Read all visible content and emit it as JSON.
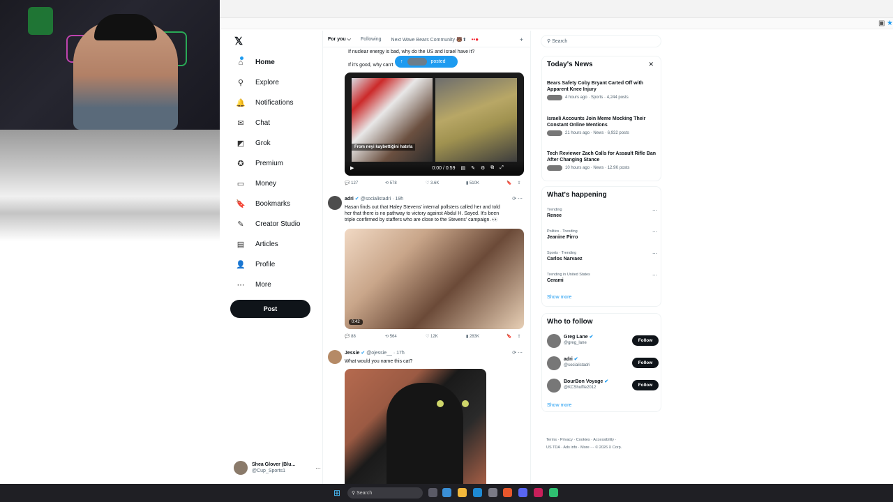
{
  "nav": {
    "logo": "𝕏",
    "items": [
      {
        "label": "Home",
        "icon": "⌂"
      },
      {
        "label": "Explore",
        "icon": "⚲"
      },
      {
        "label": "Notifications",
        "icon": "🔔"
      },
      {
        "label": "Chat",
        "icon": "✉"
      },
      {
        "label": "Grok",
        "icon": "◩"
      },
      {
        "label": "Premium",
        "icon": "✪"
      },
      {
        "label": "Money",
        "icon": "▭"
      },
      {
        "label": "Bookmarks",
        "icon": "🔖"
      },
      {
        "label": "Creator Studio",
        "icon": "✎"
      },
      {
        "label": "Articles",
        "icon": "▤"
      },
      {
        "label": "Profile",
        "icon": "👤"
      },
      {
        "label": "More",
        "icon": "⋯"
      }
    ],
    "post_label": "Post",
    "account": {
      "name": "Shea Glover (Blu...",
      "handle": "@Cup_Sports1"
    }
  },
  "tabs": {
    "items": [
      "For you",
      "Following",
      "Next Wave Bears Community 🐻⬆"
    ],
    "chevron": "⌵",
    "dots": "••●",
    "plus": "+"
  },
  "feed": {
    "line1": "If nuclear energy is bad, why do the US and Israel have it?",
    "line2": "If it's good, why can't",
    "posted_label": "posted",
    "video1": {
      "caption": "From neyi kaybettiğini hatırla",
      "time": "0:00 / 0:59",
      "actions": {
        "replies": "127",
        "reposts": "578",
        "likes": "3.6K",
        "views": "510K"
      }
    },
    "tweet2": {
      "name": "adri",
      "handle": "@socialistadri · 19h",
      "text1": "Hasan finds out that Haley Stevens' internal pollsters called her and told",
      "text2": "her that there is no pathway to victory against Abdul H. Sayed. It's been",
      "text3": "triple confirmed by staffers who are close to the Stevens' campaign. 👀",
      "duration": "0:42",
      "actions": {
        "replies": "88",
        "reposts": "564",
        "likes": "12K",
        "views": "283K"
      }
    },
    "tweet3": {
      "name": "Jessie",
      "handle": "@ojessie__ · 17h",
      "text": "What would you name this cat?"
    }
  },
  "sidebar": {
    "search_placeholder": "Search",
    "news": {
      "title": "Today's News",
      "items": [
        {
          "title": "Bears Safety Coby Bryant Carted Off with Apparent Knee Injury",
          "meta": "4 hours ago · Sports · 4,244 posts"
        },
        {
          "title": "Israeli Accounts Join Meme Mocking Their Constant Online Mentions",
          "meta": "21 hours ago · News · 6,932 posts"
        },
        {
          "title": "Tech Reviewer Zach Calls for Assault Rifle Ban After Changing Stance",
          "meta": "10 hours ago · News · 12.9K posts"
        }
      ]
    },
    "happening": {
      "title": "What's happening",
      "items": [
        {
          "context": "Trending",
          "name": "Renee"
        },
        {
          "context": "Politics · Trending",
          "name": "Jeanine Pirro"
        },
        {
          "context": "Sports · Trending",
          "name": "Carlos Narvaez"
        },
        {
          "context": "Trending in United States",
          "name": "Cerami"
        }
      ],
      "show_more": "Show more"
    },
    "follow": {
      "title": "Who to follow",
      "items": [
        {
          "name": "Greg Lane",
          "handle": "@greg_lane"
        },
        {
          "name": "adri",
          "handle": "@socialistadri"
        },
        {
          "name": "BourBon Voyage",
          "handle": "@KCShuffle2012"
        }
      ],
      "button_label": "Follow",
      "show_more": "Show more"
    },
    "footer": {
      "line1": "Terms · Privacy · Cookies · Accessibility ·",
      "line2": "US TDA · Ads info · More ··· © 2026 X Corp."
    }
  },
  "taskbar": {
    "search_placeholder": "Search"
  },
  "colors": {
    "accent": "#1d9bf0",
    "text": "#0f1419",
    "muted": "#536471",
    "button": "#0f1419"
  }
}
